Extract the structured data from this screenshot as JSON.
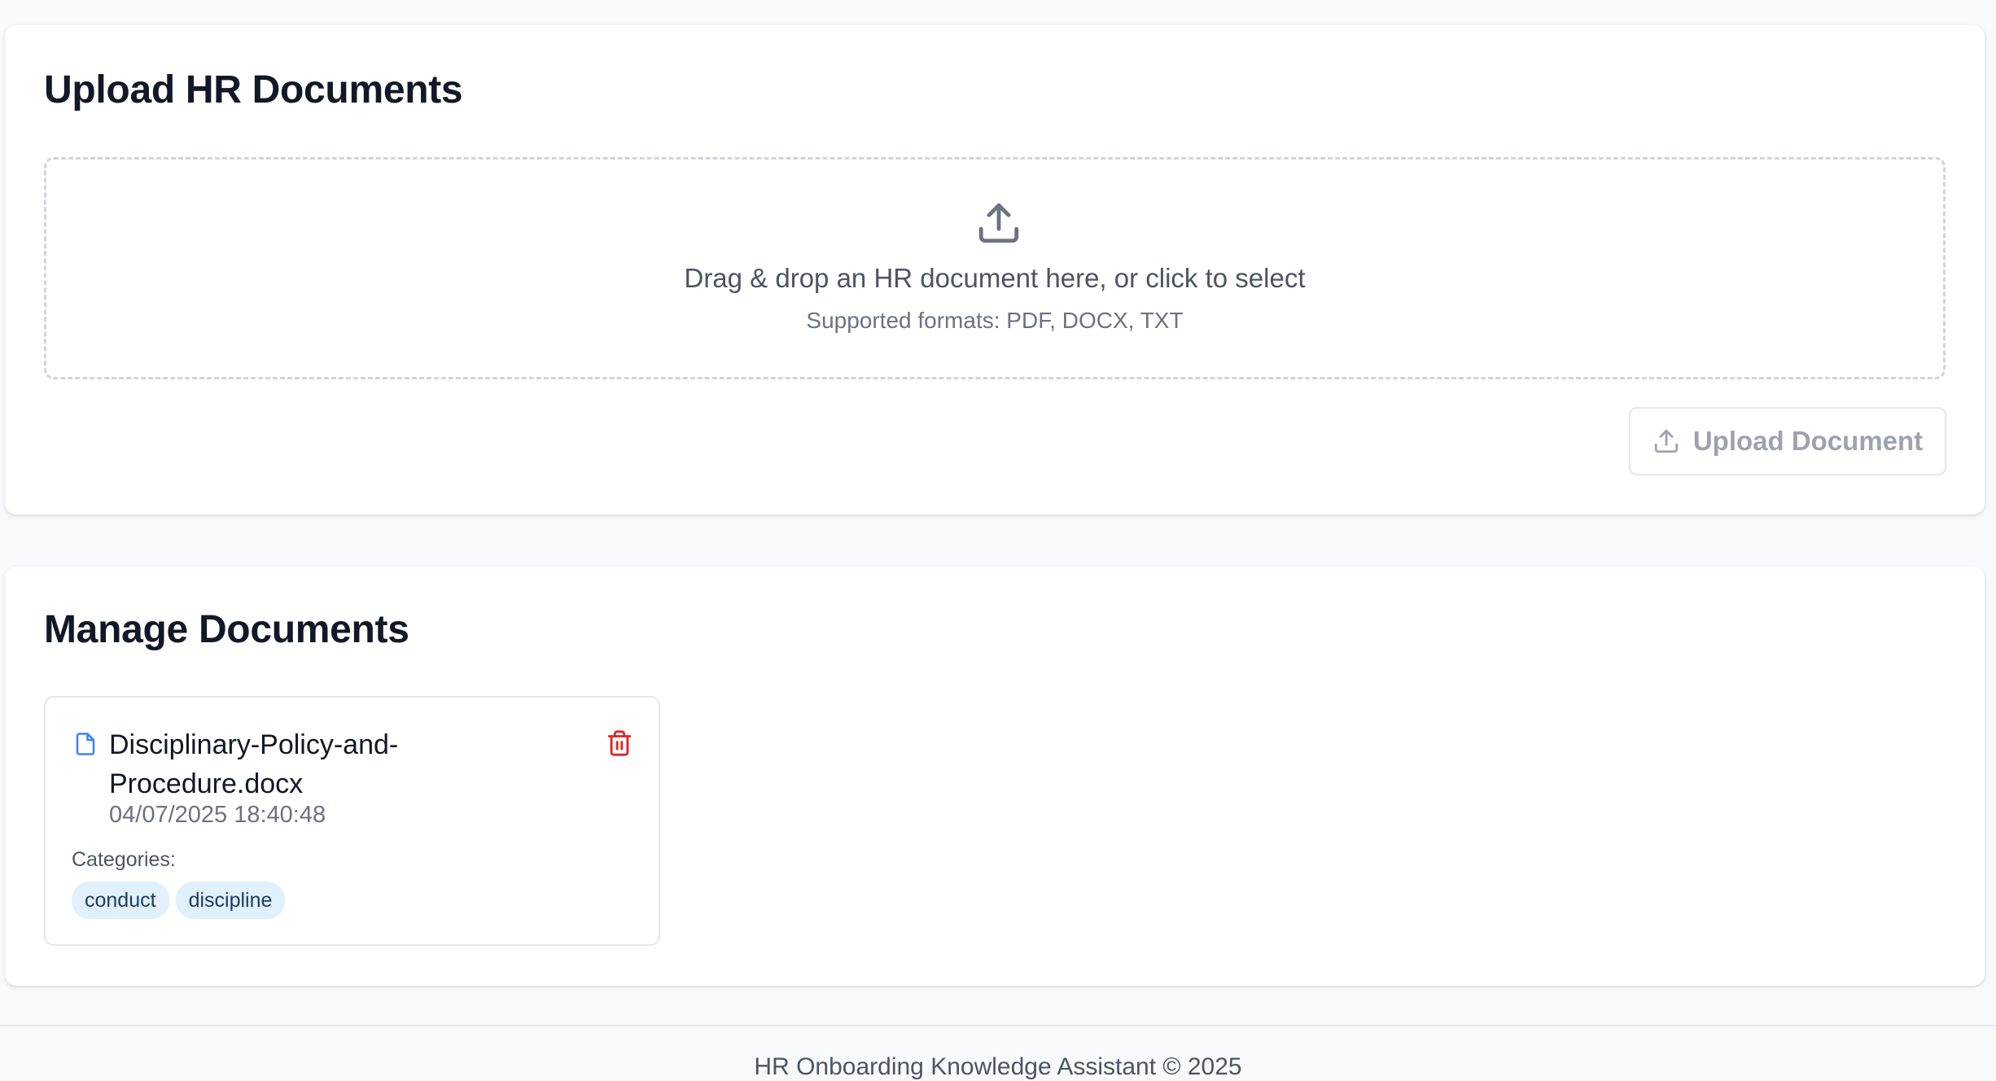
{
  "upload": {
    "title": "Upload HR Documents",
    "dropzone_text": "Drag & drop an HR document here, or click to select",
    "supported_formats": "Supported formats: PDF, DOCX, TXT",
    "button_label": "Upload Document"
  },
  "manage": {
    "title": "Manage Documents",
    "documents": [
      {
        "name": "Disciplinary-Policy-and-Procedure.docx",
        "date": "04/07/2025 18:40:48",
        "categories_label": "Categories:",
        "categories": [
          "conduct",
          "discipline"
        ]
      }
    ]
  },
  "footer": {
    "text": "HR Onboarding Knowledge Assistant © 2025"
  },
  "colors": {
    "accent_blue": "#3b82f6",
    "delete_red": "#dc2626",
    "tag_bg": "#e0f0fc"
  }
}
